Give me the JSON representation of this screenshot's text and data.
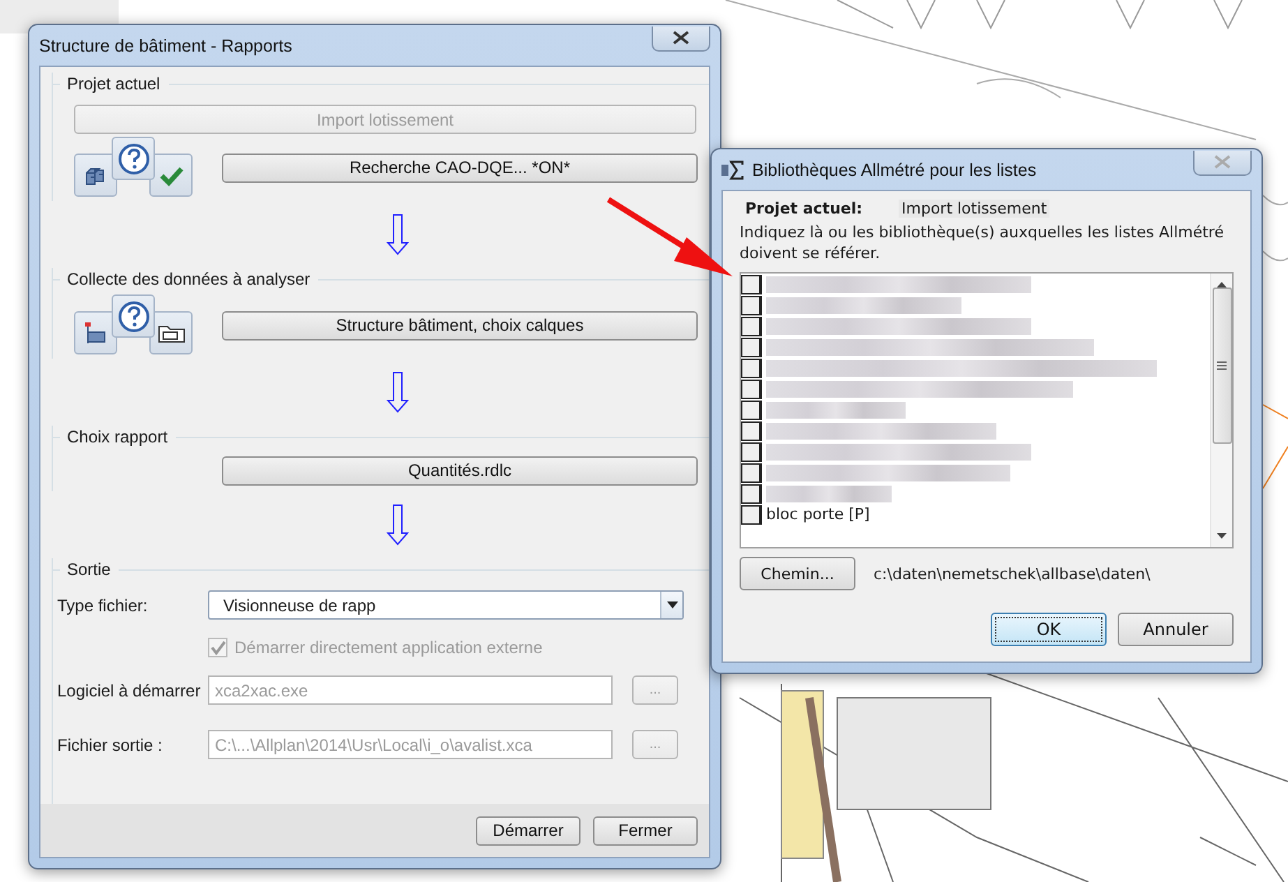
{
  "main_window": {
    "title": "Structure de bâtiment - Rapports",
    "sections": [
      {
        "kind": "project",
        "legend": "Projet actuel",
        "top_button": {
          "label": "Import lotissement",
          "disabled": true
        },
        "action_button": {
          "label": "Recherche CAO-DQE... *ON*",
          "disabled": false
        }
      },
      {
        "kind": "collect",
        "legend": "Collecte des données à analyser",
        "action_button": {
          "label": "Structure bâtiment, choix calques",
          "disabled": false
        }
      },
      {
        "kind": "report",
        "legend": "Choix rapport",
        "action_button": {
          "label": "Quantités.rdlc",
          "disabled": false
        }
      }
    ],
    "output": {
      "legend": "Sortie",
      "file_type": {
        "label": "Type fichier:",
        "value": "Visionneuse de rapp"
      },
      "launch_checkbox": {
        "label": "Démarrer directement application externe",
        "checked": true,
        "disabled": true
      },
      "fields": [
        {
          "label": "Logiciel à démarrer",
          "value": "xca2xac.exe",
          "disabled": true,
          "browse": "..."
        },
        {
          "label": "Fichier sortie :",
          "value": "C:\\...\\Allplan\\2014\\Usr\\Local\\i_o\\avalist.xca",
          "disabled": true,
          "browse": "..."
        }
      ]
    },
    "buttons": [
      "Démarrer",
      "Fermer"
    ]
  },
  "library_window": {
    "title": "Bibliothèques Allmétré pour les listes",
    "project_label": "Projet actuel:",
    "project_value": "Import lotissement",
    "instructions": "Indiquez là ou les bibliothèque(s) auxquelles les listes Allmétré doivent se référer.",
    "libraries": [
      {
        "kind": "blurred",
        "checked": false
      },
      {
        "kind": "blurred",
        "checked": false
      },
      {
        "kind": "blurred",
        "checked": false
      },
      {
        "kind": "blurred",
        "checked": false
      },
      {
        "kind": "blurred",
        "checked": false
      },
      {
        "kind": "blurred",
        "checked": false
      },
      {
        "kind": "blurred",
        "checked": false
      },
      {
        "kind": "blurred",
        "checked": false
      },
      {
        "kind": "blurred",
        "checked": false
      },
      {
        "kind": "blurred",
        "checked": false
      },
      {
        "kind": "blurred",
        "checked": false
      },
      {
        "kind": "text",
        "label": "bloc porte [P]",
        "checked": false
      }
    ],
    "path_button": "Chemin...",
    "path": "c:\\daten\\nemetschek\\allbase\\daten\\",
    "buttons": [
      {
        "label": "OK",
        "default": true
      },
      {
        "label": "Annuler",
        "default": false
      }
    ]
  }
}
